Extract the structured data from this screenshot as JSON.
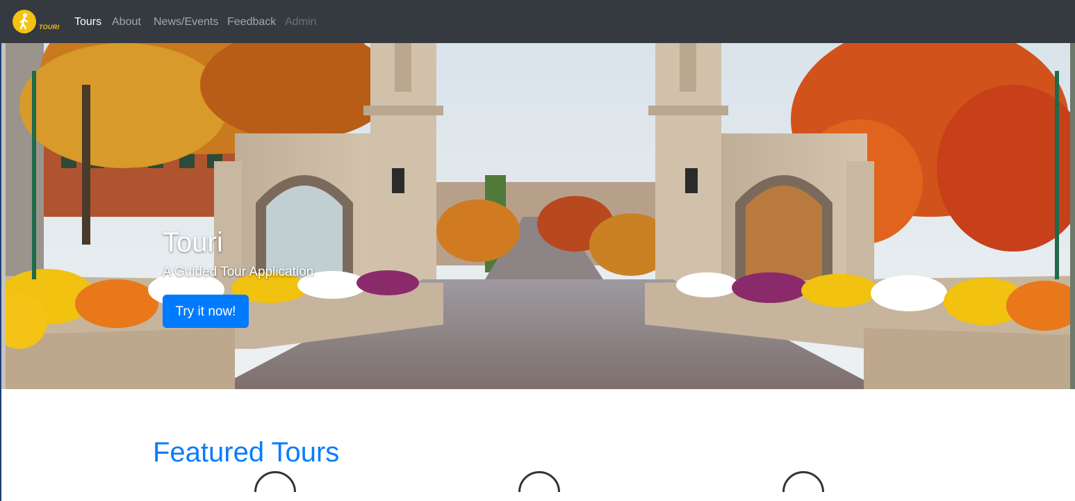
{
  "navbar": {
    "brand_text": "TOURI",
    "links": [
      {
        "label": "Tours",
        "state": "active"
      },
      {
        "label": "About",
        "state": "normal"
      },
      {
        "label": "News/Events",
        "state": "normal"
      },
      {
        "label": "Feedback",
        "state": "normal"
      },
      {
        "label": "Admin",
        "state": "disabled"
      }
    ]
  },
  "hero": {
    "title": "Touri",
    "subtitle": "A Guided Tour Application",
    "button_label": "Try it now!"
  },
  "featured": {
    "heading": "Featured Tours"
  },
  "colors": {
    "navbar_bg": "#343a40",
    "primary": "#007bff",
    "brand_yellow": "#f5c211",
    "heading_blue": "#0a7bff"
  }
}
